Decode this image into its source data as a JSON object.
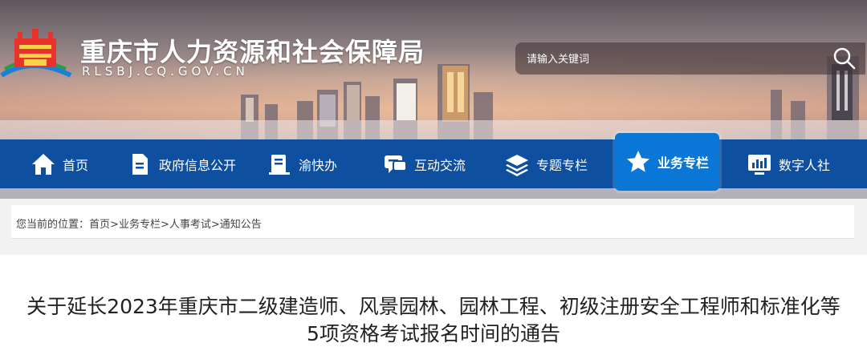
{
  "header": {
    "site_title": "重庆市人力资源和社会保障局",
    "site_domain": "RLSBJ.CQ.GOV.CN",
    "search": {
      "placeholder": "请输入关键词",
      "icon": "search-icon"
    }
  },
  "nav": {
    "items": [
      {
        "label": "首页",
        "icon": "home-icon",
        "active": false
      },
      {
        "label": "政府信息公开",
        "icon": "document-icon",
        "active": false
      },
      {
        "label": "渝快办",
        "icon": "clipboard-icon",
        "active": false
      },
      {
        "label": "互动交流",
        "icon": "chat-icon",
        "active": false
      },
      {
        "label": "专题专栏",
        "icon": "layers-icon",
        "active": false
      },
      {
        "label": "业务专栏",
        "icon": "star-icon",
        "active": true
      },
      {
        "label": "数字人社",
        "icon": "monitor-chart-icon",
        "active": false
      }
    ],
    "colors": {
      "bar": "#0e4f9f",
      "active": "#0a76d6"
    }
  },
  "breadcrumb": {
    "prefix": "您当前的位置：",
    "items": [
      "首页",
      "业务专栏",
      "人事考试",
      "通知公告"
    ],
    "separator": ">"
  },
  "article": {
    "title": "关于延长2023年重庆市二级建造师、风景园林、园林工程、初级注册安全工程师和标准化等5项资格考试报名时间的通告"
  }
}
